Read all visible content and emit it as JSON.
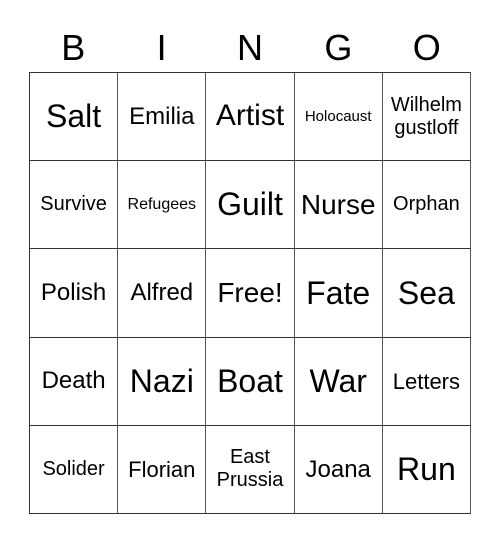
{
  "header": [
    "B",
    "I",
    "N",
    "G",
    "O"
  ],
  "rows": [
    [
      "Salt",
      "Emilia",
      "Artist",
      "Holocaust",
      "Wilhelm\ngustloff"
    ],
    [
      "Survive",
      "Refugees",
      "Guilt",
      "Nurse",
      "Orphan"
    ],
    [
      "Polish",
      "Alfred",
      "Free!",
      "Fate",
      "Sea"
    ],
    [
      "Death",
      "Nazi",
      "Boat",
      "War",
      "Letters"
    ],
    [
      "Solider",
      "Florian",
      "East\nPrussia",
      "Joana",
      "Run"
    ]
  ]
}
